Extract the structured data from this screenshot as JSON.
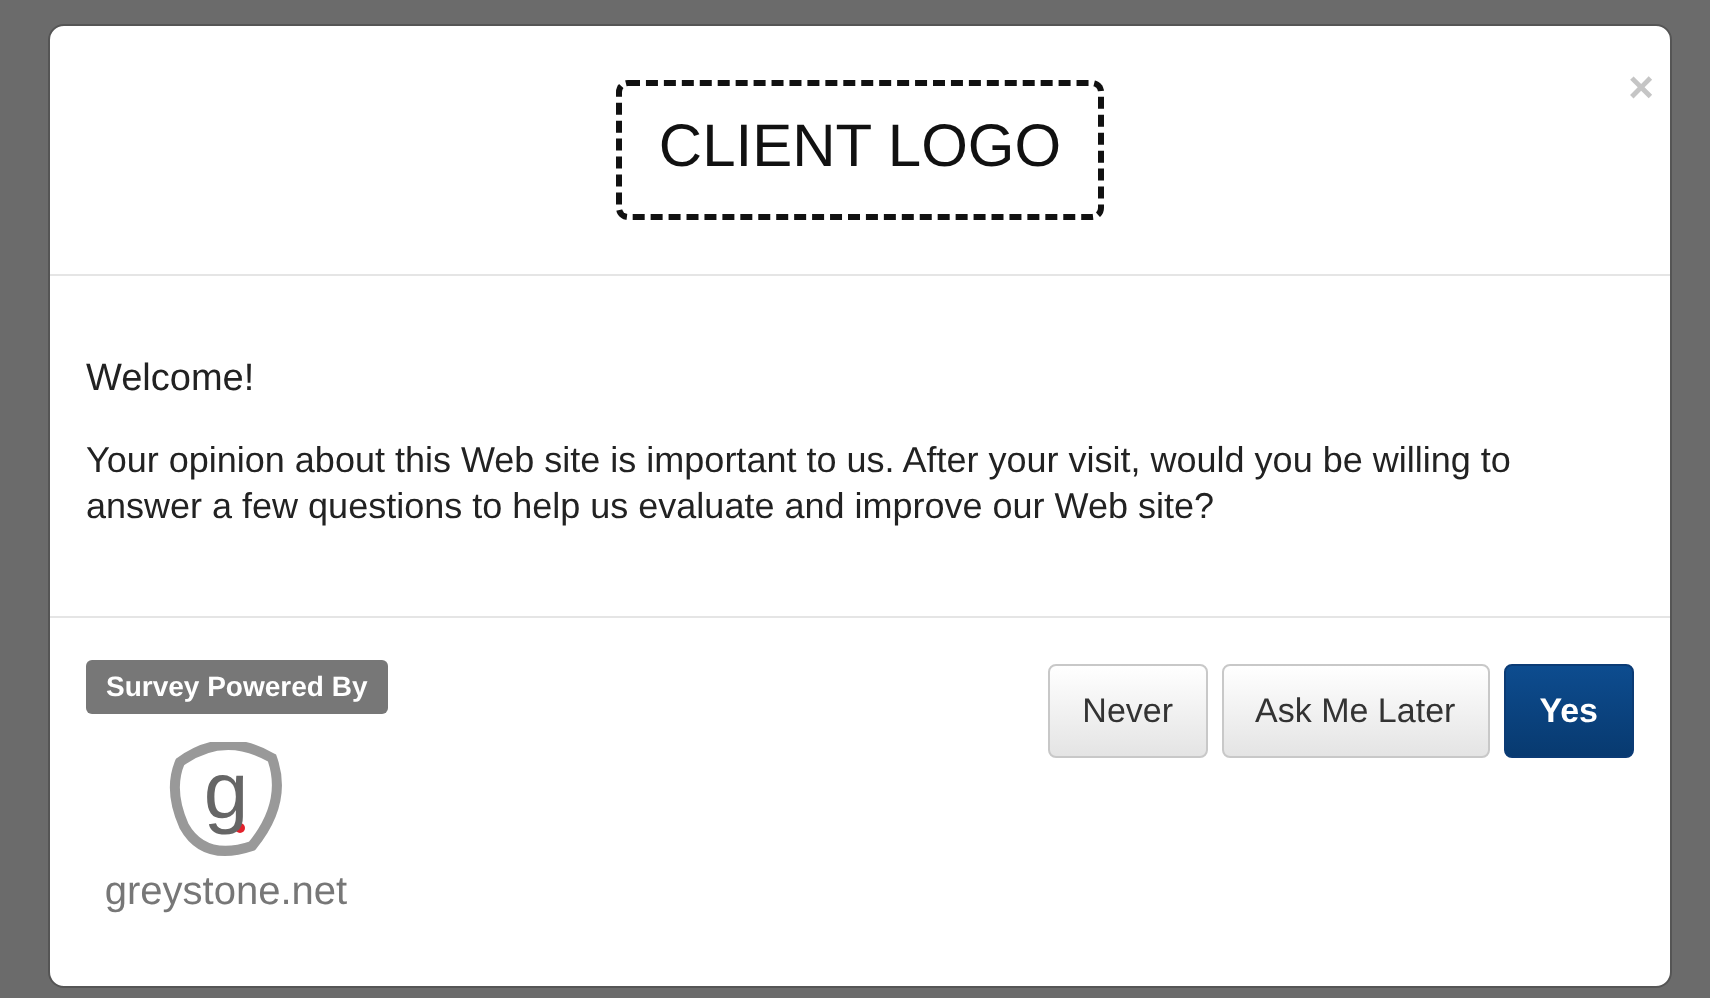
{
  "modal": {
    "logo_text": "CLIENT LOGO",
    "close": "×",
    "title": "Welcome!",
    "message": "Your opinion about this Web site is important to us. After your visit, would you be willing to answer a few questions to help us evaluate and improve our Web site?",
    "powered_by": "Survey Powered By",
    "brand_mark": "g",
    "brand_name": "greystone.net",
    "buttons": [
      {
        "label": "Never",
        "kind": "default"
      },
      {
        "label": "Ask Me Later",
        "kind": "default"
      },
      {
        "label": "Yes",
        "kind": "primary"
      }
    ]
  }
}
